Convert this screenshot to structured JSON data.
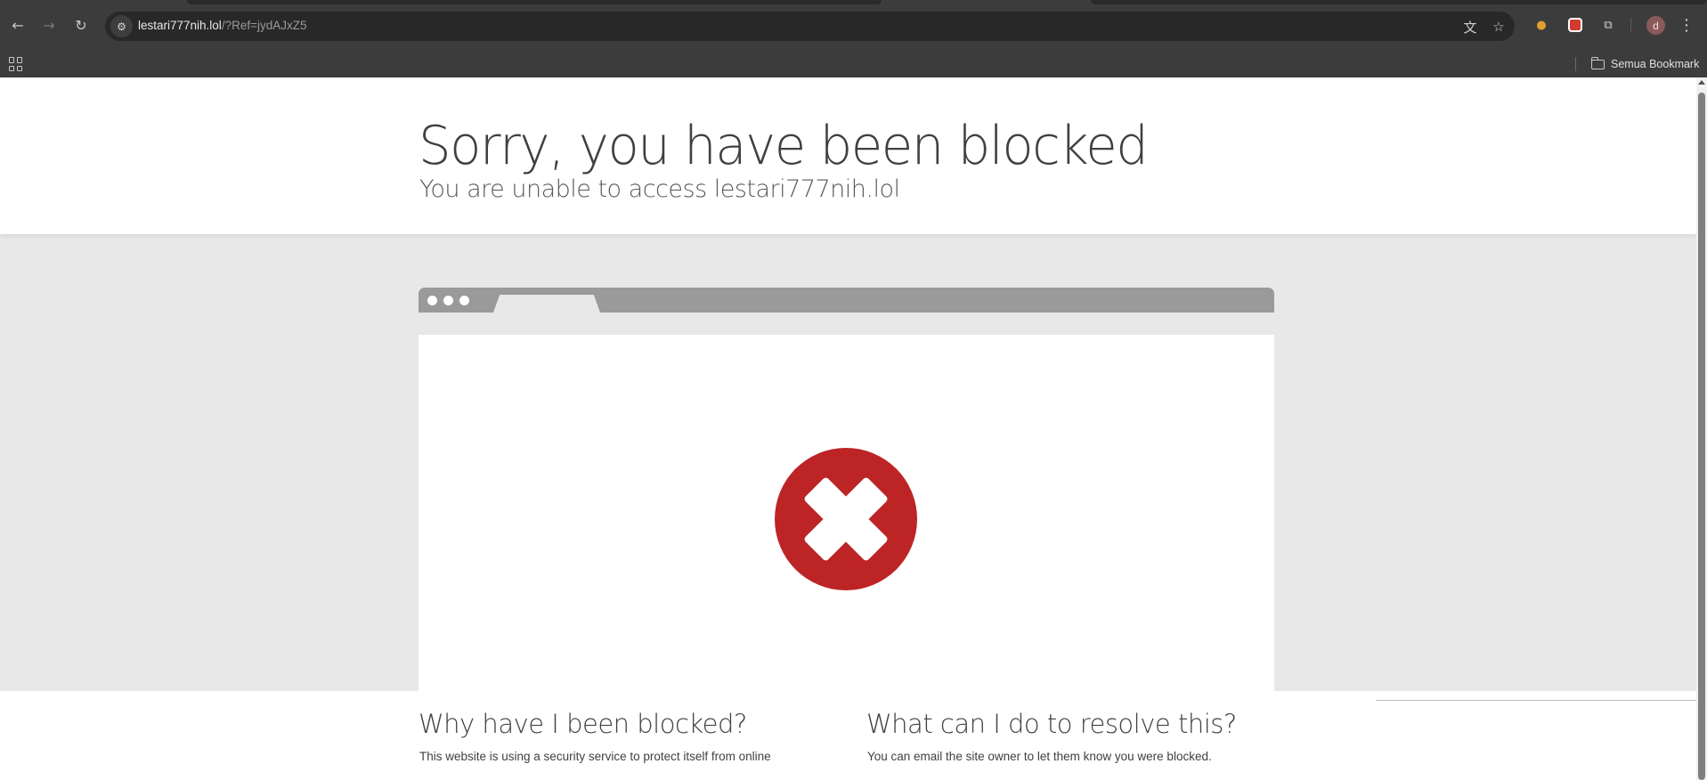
{
  "browser": {
    "back_icon": "arrow-left-icon",
    "forward_icon": "arrow-right-icon",
    "reload_icon": "reload-icon",
    "site_info_icon": "tune-icon",
    "url_host": "lestari777nih.lol",
    "url_path": "/?Ref=jydAJxZ5",
    "translate_icon": "translate-icon",
    "bookmark_star_icon": "star-icon",
    "extensions": [
      "extension-person-icon",
      "extension-red-icon",
      "puzzle-icon"
    ],
    "profile_initial": "d",
    "menu_icon": "kebab-menu-icon"
  },
  "bookmarks_bar": {
    "apps_icon": "apps-grid-icon",
    "all_bookmarks_label": "Semua Bookmark"
  },
  "page": {
    "title": "Sorry, you have been blocked",
    "subtitle": "You are unable to access lestari777nih.lol",
    "illustration_icon": "blocked-x-icon",
    "colors": {
      "error_red": "#bd2426",
      "header_bg": "#ffffff",
      "body_bg": "#e8e8e8",
      "illustration_gray": "#9a9a9a"
    },
    "why_heading": "Why have I been blocked?",
    "why_text": "This website is using a security service to protect itself from online",
    "resolve_heading": "What can I do to resolve this?",
    "resolve_text": "You can email the site owner to let them know you were blocked."
  }
}
